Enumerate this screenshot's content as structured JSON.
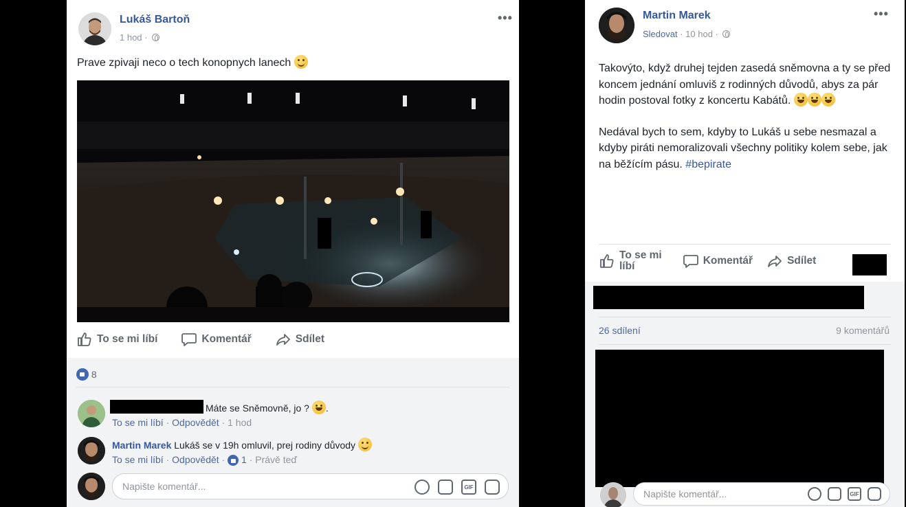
{
  "left_post": {
    "author": "Lukáš Bartoň",
    "time": "1 hod",
    "more": "•••",
    "text": "Prave zpivaji neco o tech konopnych lanech",
    "actions": {
      "like": "To se mi líbí",
      "comment": "Komentář",
      "share": "Sdílet"
    },
    "reaction_count": "8",
    "comments": [
      {
        "text": "Máte se Sněmovně, jo ?",
        "text_end": ".",
        "actions": {
          "like": "To se mi líbí",
          "reply": "Odpovědět",
          "time": "1 hod"
        }
      },
      {
        "author": "Martin Marek",
        "text": "Lukáš se v 19h omluvil, prej rodiny důvody",
        "actions": {
          "like": "To se mi líbí",
          "reply": "Odpovědět",
          "likes": "1",
          "time": "Právě teď"
        }
      }
    ],
    "comment_placeholder": "Napište komentář..."
  },
  "right_post": {
    "author": "Martin Marek",
    "follow": "Sledovat",
    "time": "10 hod",
    "more": "•••",
    "paragraph1": "Takovýto, když druhej tejden zasedá sněmovna a ty se před koncem jednání omluviš z rodinných důvodů, abys za pár hodin postoval fotky z koncertu Kabátů.",
    "paragraph2": "Nedával bych to sem, kdyby to Lukáš u sebe nesmazal a kdyby piráti nemoralizovali všechny politiky kolem sebe, jak na běžícím pásu.",
    "hashtag": "#bepirate",
    "actions": {
      "like_line1": "To se mi",
      "like_line2": "líbí",
      "comment": "Komentář",
      "share": "Sdílet"
    },
    "shares": "26 sdílení",
    "comments_count": "9 komentářů",
    "comment_placeholder": "Napište komentář..."
  },
  "colors": {
    "link": "#365899",
    "meta": "#90949c",
    "like_blue": "#4267b2",
    "comment_bg": "#f2f3f5"
  },
  "icons": [
    "globe-icon",
    "more-options-icon",
    "thumbs-up-icon",
    "comment-icon",
    "share-icon",
    "emoji-icon",
    "camera-icon",
    "gif-icon",
    "sticker-icon"
  ]
}
